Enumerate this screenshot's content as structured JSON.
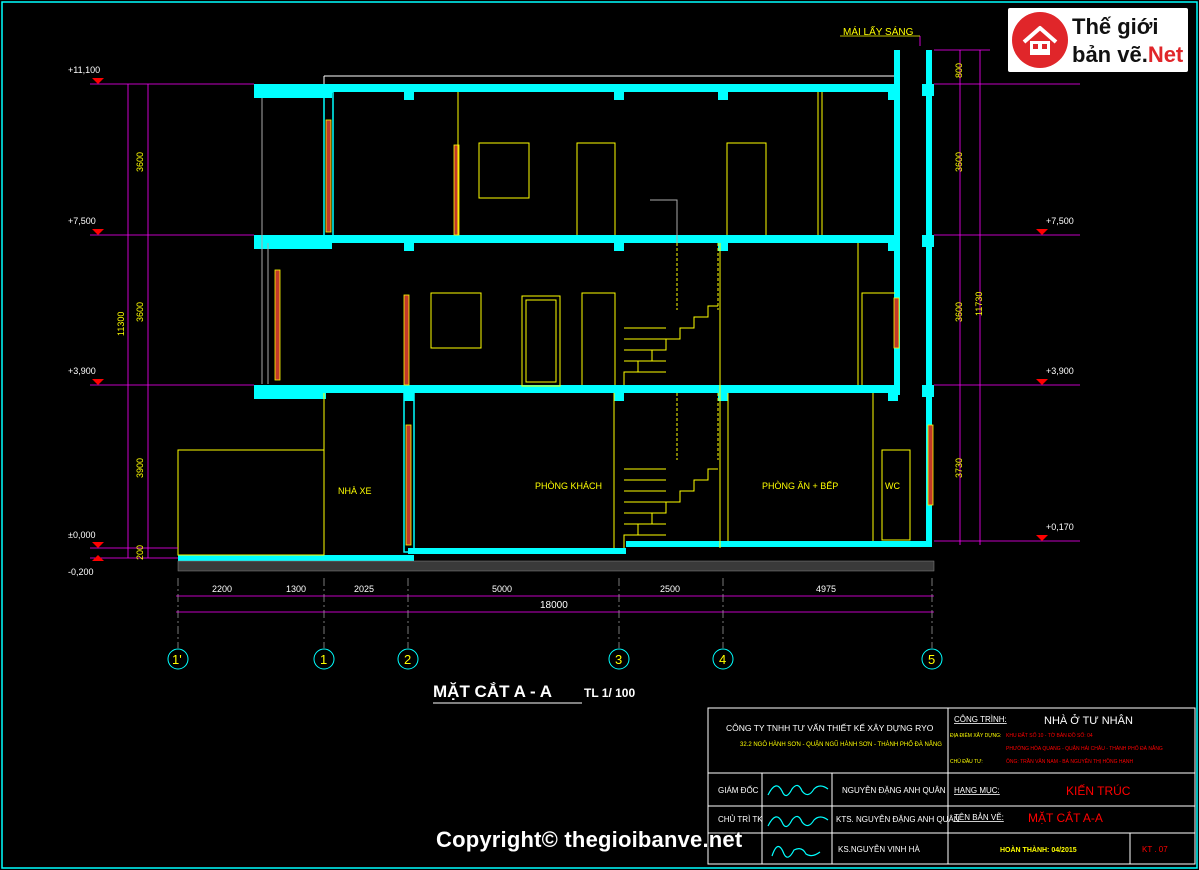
{
  "logo": {
    "line1": "Thế giới",
    "line2_a": "bản vẽ.",
    "line2_b": "Net"
  },
  "copyright": "Copyright© thegioibanve.net",
  "drawing": {
    "title": "MẶT CẮT A - A",
    "scale": "TL 1/ 100",
    "mai_lay_sang": "MÁI LẤY SÁNG",
    "rooms": [
      "NHÀ XE",
      "PHÒNG KHÁCH",
      "PHÒNG ĂN + BẾP",
      "WC"
    ],
    "levels_left": [
      "+11,100",
      "+7,500",
      "+3,900",
      "±0,000",
      "-0,200"
    ],
    "levels_right": [
      "+7,500",
      "+3,900",
      "+0,170"
    ],
    "left_dims": [
      "3600",
      "3600",
      "3900",
      "200"
    ],
    "left_total": "11300",
    "right_dims": [
      "800",
      "3600",
      "3600",
      "3730"
    ],
    "right_total": "11730",
    "bottom_dims": [
      "2200",
      "1300",
      "2025",
      "5000",
      "2500",
      "4975"
    ],
    "bottom_total": "18000",
    "axes": [
      "1'",
      "1",
      "2",
      "3",
      "4",
      "5"
    ]
  },
  "titleblock": {
    "company": "CÔNG TY TNHH TƯ VẤN THIẾT KẾ XÂY DỰNG RYO",
    "address": "32.2 NGÔ HÀNH SƠN - QUẬN NGŨ HÀNH SƠN - THÀNH PHỐ ĐÀ NẴNG",
    "cong_trinh_label": "CÔNG TRÌNH:",
    "cong_trinh": "NHÀ Ở TƯ NHÂN",
    "dia_diem_label": "ĐỊA ĐIỂM XÂY DỰNG:",
    "dia_diem_1": "KHU ĐẤT SỐ 10 - TỜ BẢN ĐỒ SỐ: 04",
    "dia_diem_2": "PHƯỜNG HÒA QUANG - QUẬN HẢI CHÂU - THÀNH PHỐ ĐÀ NẴNG",
    "chu_dau_tu_label": "CHỦ ĐẦU TƯ:",
    "chu_dau_tu": "ÔNG: TRẦN VĂN NAM - BÀ NGUYỄN THỊ HỒNG HẠNH",
    "giam_doc_label": "GIÁM ĐỐC",
    "giam_doc": "NGUYỄN ĐẶNG ANH QUÂN",
    "chu_tri_label": "CHỦ TRÌ TK",
    "chu_tri": "KTS. NGUYỄN ĐẶNG ANH QUÂN",
    "ks_name": "KS.NGUYỄN VINH HÀ",
    "hang_muc_label": "HẠNG MỤC:",
    "hang_muc": "KIẾN TRÚC",
    "ten_ban_ve_label": "TÊN BẢN VẼ:",
    "ten_ban_ve": "MẶT CẮT A-A",
    "hoan_thanh": "HOÀN THÀNH: 04/2015",
    "ma_ban_ve": "KT . 07"
  },
  "colors": {
    "cyan": "#00ffff",
    "yellow": "#ffff00",
    "magenta": "#ff00ff",
    "red": "#ff0000",
    "white": "#ffffff",
    "green": "#00ff00"
  }
}
